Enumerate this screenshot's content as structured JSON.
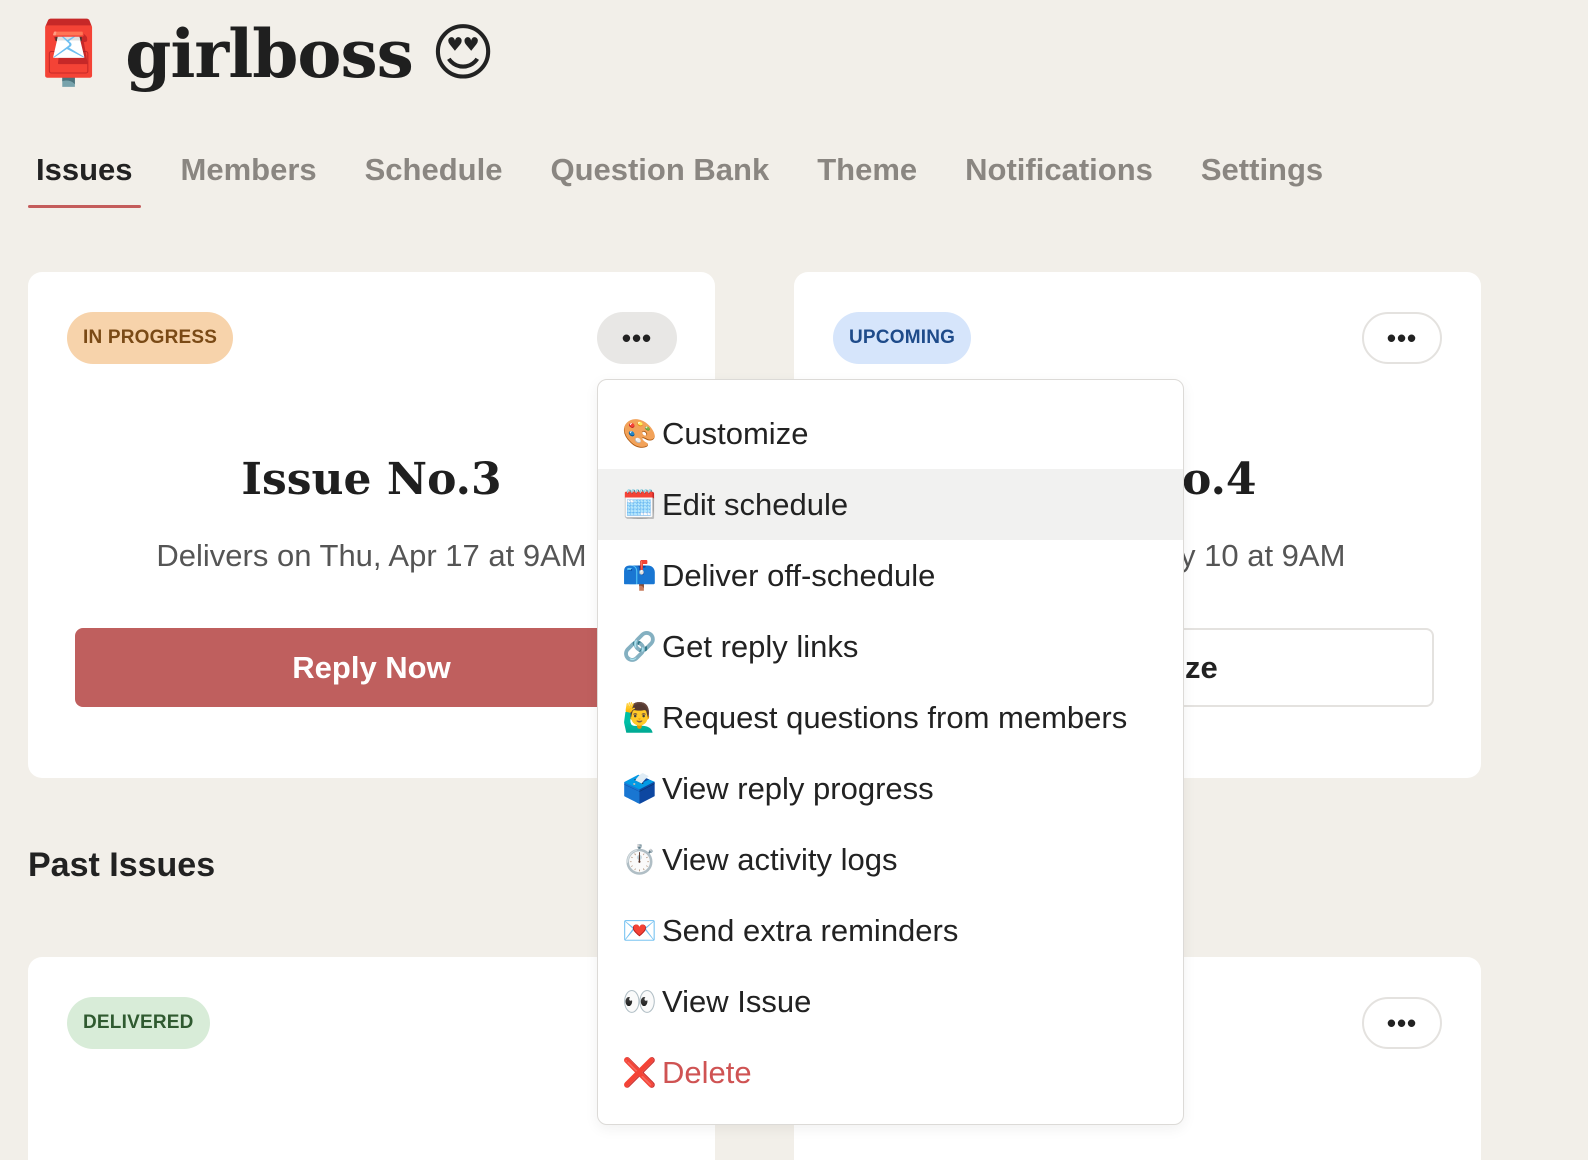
{
  "app": {
    "logo_emoji": "📮",
    "title": "girlboss",
    "title_emoji": "😍"
  },
  "tabs": [
    {
      "label": "Issues",
      "active": true
    },
    {
      "label": "Members",
      "active": false
    },
    {
      "label": "Schedule",
      "active": false
    },
    {
      "label": "Question Bank",
      "active": false
    },
    {
      "label": "Theme",
      "active": false
    },
    {
      "label": "Notifications",
      "active": false
    },
    {
      "label": "Settings",
      "active": false
    }
  ],
  "current_issue": {
    "badge": "IN PROGRESS",
    "more": "•••",
    "title": "Issue No.3",
    "delivery": "Delivers on Thu, Apr 17 at 9AM",
    "button": "Reply Now"
  },
  "upcoming_issue": {
    "badge": "UPCOMING",
    "more": "•••",
    "title_visible": "o.4",
    "delivery_visible": "y 10 at 9AM",
    "button_visible": "ze"
  },
  "past_issues": {
    "heading": "Past Issues",
    "items": [
      {
        "badge": "DELIVERED",
        "more": "•••"
      }
    ]
  },
  "menu": {
    "items": [
      {
        "icon": "🎨",
        "icon_name": "palette-icon",
        "label": "Customize"
      },
      {
        "icon": "🗓️",
        "icon_name": "calendar-icon",
        "label": "Edit schedule",
        "hover": true
      },
      {
        "icon": "📫",
        "icon_name": "mailbox-icon",
        "label": "Deliver off-schedule"
      },
      {
        "icon": "🔗",
        "icon_name": "link-icon",
        "label": "Get reply links"
      },
      {
        "icon": "🙋‍♂️",
        "icon_name": "raising-hand-icon",
        "label": "Request questions from members"
      },
      {
        "icon": "🗳️",
        "icon_name": "ballot-box-icon",
        "label": "View reply progress"
      },
      {
        "icon": "⏱️",
        "icon_name": "stopwatch-icon",
        "label": "View activity logs"
      },
      {
        "icon": "💌",
        "icon_name": "love-letter-icon",
        "label": "Send extra reminders"
      },
      {
        "icon": "👀",
        "icon_name": "eyes-icon",
        "label": "View Issue"
      },
      {
        "icon": "❌",
        "icon_name": "cross-mark-icon",
        "label": "Delete",
        "danger": true
      }
    ]
  },
  "colors": {
    "background": "#f2efe9",
    "accent": "#bf5f5e",
    "danger": "#cf5353"
  }
}
